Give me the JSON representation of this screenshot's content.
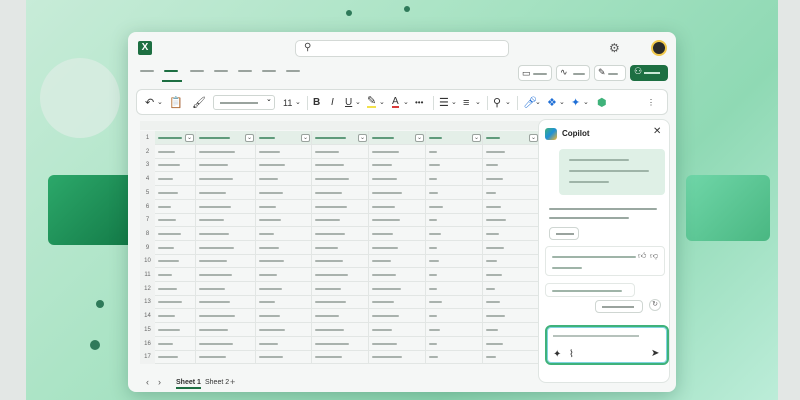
{
  "app": {
    "logo_letter": "X",
    "accent": "#1d6f42"
  },
  "search": {
    "icon": "search-icon",
    "placeholder": ""
  },
  "header": {
    "settings_icon": "gear-icon",
    "avatar": "avatar"
  },
  "toolbar": {
    "font_size": "11",
    "bold": "B",
    "italic": "I",
    "underline": "U",
    "font_color_letter": "A",
    "more": "•••"
  },
  "grid": {
    "row_numbers": [
      "1",
      "2",
      "3",
      "4",
      "5",
      "6",
      "7",
      "8",
      "9",
      "10",
      "11",
      "12",
      "13",
      "14",
      "15",
      "16",
      "17"
    ]
  },
  "sheets": {
    "tabs": [
      "Sheet 1",
      "Sheet 2"
    ],
    "add": "+"
  },
  "copilot": {
    "title": "Copilot",
    "close": "✕"
  }
}
